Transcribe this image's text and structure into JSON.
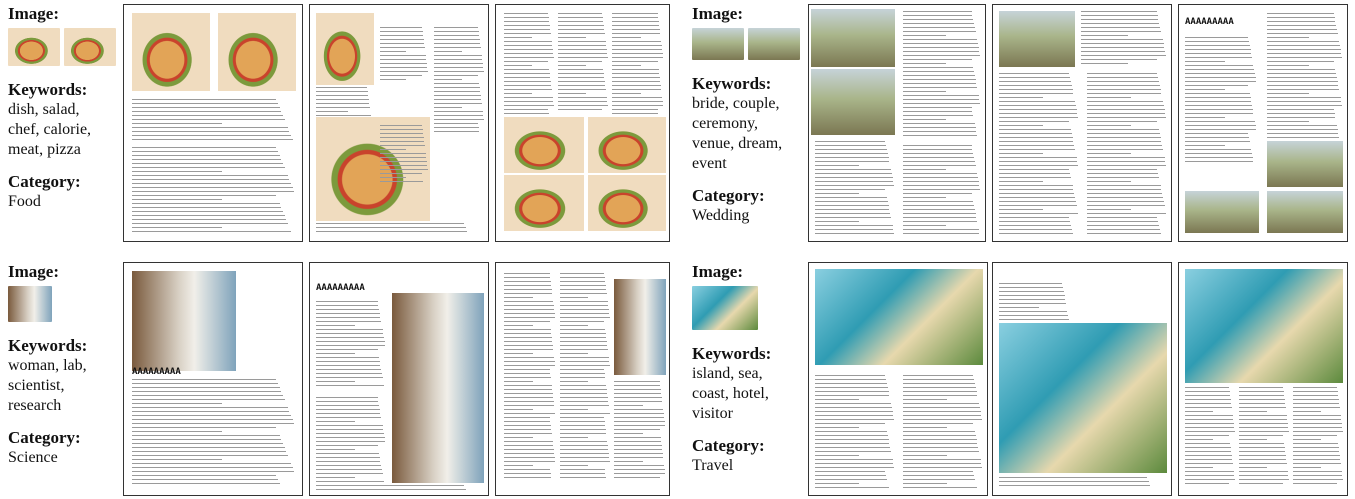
{
  "labels": {
    "image": "Image:",
    "keywords": "Keywords:",
    "category": "Category:"
  },
  "examples": [
    {
      "keywords": "dish, salad, chef, calorie, meat, pizza",
      "keywords_lines": [
        "dish, salad,",
        "chef, calorie,",
        "meat, pizza"
      ],
      "category": "Food",
      "photo_kind": "pizza"
    },
    {
      "keywords": "bride, couple, ceremony, venue, dream, event",
      "keywords_lines": [
        "bride, couple,",
        "ceremony,",
        "venue, dream,",
        "event"
      ],
      "category": "Wedding",
      "photo_kind": "wedding"
    },
    {
      "keywords": "woman, lab, scientist, research",
      "keywords_lines": [
        "woman, lab,",
        "scientist,",
        "research"
      ],
      "category": "Science",
      "photo_kind": "lab"
    },
    {
      "keywords": "island, sea, coast, hotel, visitor",
      "keywords_lines": [
        "island, sea,",
        "coast, hotel,",
        "visitor"
      ],
      "category": "Travel",
      "photo_kind": "coast"
    }
  ],
  "placeholder_heading": "AAAAAAAAA",
  "colors": {
    "page_border": "#333333",
    "text_line": "#9a9a9a"
  }
}
